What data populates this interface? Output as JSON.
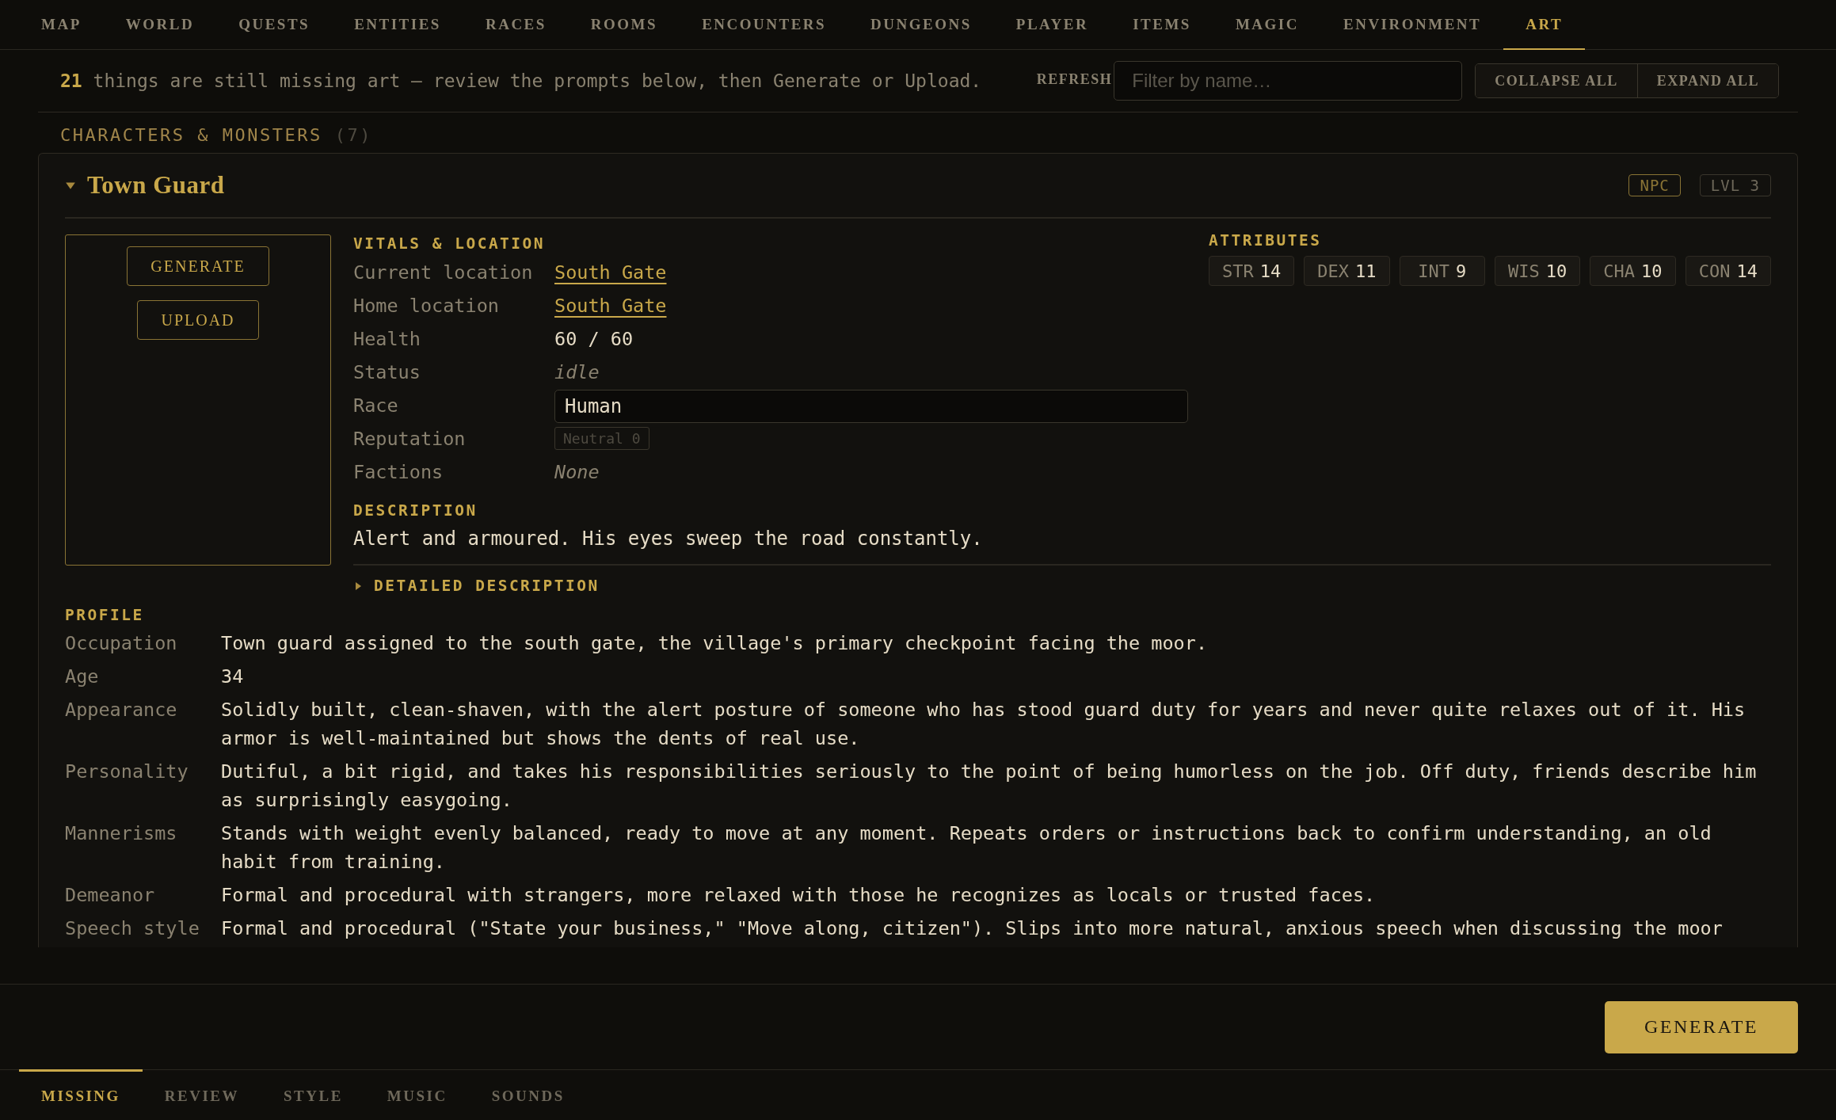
{
  "nav_tabs": [
    {
      "label": "MAP",
      "selected": false
    },
    {
      "label": "WORLD",
      "selected": false
    },
    {
      "label": "QUESTS",
      "selected": false
    },
    {
      "label": "ENTITIES",
      "selected": false
    },
    {
      "label": "RACES",
      "selected": false
    },
    {
      "label": "ROOMS",
      "selected": false
    },
    {
      "label": "ENCOUNTERS",
      "selected": false
    },
    {
      "label": "DUNGEONS",
      "selected": false
    },
    {
      "label": "PLAYER",
      "selected": false
    },
    {
      "label": "ITEMS",
      "selected": false
    },
    {
      "label": "MAGIC",
      "selected": false
    },
    {
      "label": "ENVIRONMENT",
      "selected": false
    },
    {
      "label": "ART",
      "selected": true
    }
  ],
  "toolbar": {
    "message": "**21** things are still missing art — review the prompts below, then Generate or Upload.",
    "refresh": "REFRESH",
    "filter": {
      "placeholder": "Filter by name…"
    },
    "buttons": [
      "COLLAPSE ALL",
      "EXPAND ALL"
    ]
  },
  "section": {
    "title": "CHARACTERS & MONSTERS",
    "count": "(7)"
  },
  "card": {
    "title": "Town Guard",
    "expanded": true,
    "badges": [
      {
        "label": "NPC",
        "kind": "type"
      },
      {
        "label": "LVL 3",
        "kind": "level"
      }
    ],
    "art_buttons": [
      "GENERATE",
      "UPLOAD"
    ],
    "vitals": {
      "heading": "VITALS & LOCATION",
      "rows": [
        {
          "label": "Current location",
          "value": "South Gate",
          "kind": "link"
        },
        {
          "label": "Home location",
          "value": "South Gate",
          "kind": "link"
        },
        {
          "label": "Health",
          "value": "60 / 60",
          "kind": "text"
        },
        {
          "label": "Status",
          "value": "idle",
          "kind": "italic"
        },
        {
          "label": "Race",
          "value": "Human",
          "kind": "field"
        },
        {
          "label": "Reputation",
          "value": "Neutral 0",
          "kind": "badge"
        },
        {
          "label": "Factions",
          "value": "None",
          "kind": "italic"
        }
      ]
    },
    "attributes": {
      "heading": "ATTRIBUTES",
      "items": [
        {
          "name": "STR",
          "value": "14"
        },
        {
          "name": "DEX",
          "value": "11"
        },
        {
          "name": "INT",
          "value": "9"
        },
        {
          "name": "WIS",
          "value": "10"
        },
        {
          "name": "CHA",
          "value": "10"
        },
        {
          "name": "CON",
          "value": "14"
        }
      ]
    },
    "description": {
      "heading": "DESCRIPTION",
      "text": "Alert and armoured. His eyes sweep the road constantly."
    },
    "detailed_description": {
      "label": "DETAILED DESCRIPTION",
      "expanded": false
    },
    "profile": {
      "heading": "PROFILE",
      "rows": [
        {
          "label": "Occupation",
          "value": "Town guard assigned to the south gate, the village's primary checkpoint facing the moor."
        },
        {
          "label": "Age",
          "value": "34"
        },
        {
          "label": "Appearance",
          "value": "Solidly built, clean-shaven, with the alert posture of someone who has stood guard duty for years and never quite relaxes out of it. His armor is well-maintained but shows the dents of real use."
        },
        {
          "label": "Personality",
          "value": "Dutiful, a bit rigid, and takes his responsibilities seriously to the point of being humorless on the job. Off duty, friends describe him as surprisingly easygoing."
        },
        {
          "label": "Mannerisms",
          "value": "Stands with weight evenly balanced, ready to move at any moment. Repeats orders or instructions back to confirm understanding, an old habit from training."
        },
        {
          "label": "Demeanor",
          "value": "Formal and procedural with strangers, more relaxed with those he recognizes as locals or trusted faces."
        },
        {
          "label": "Speech style",
          "value": "Formal and procedural (\"State your business,\" \"Move along, citizen\"). Slips into more natural, anxious speech when discussing the moor"
        }
      ]
    }
  },
  "footer": {
    "generate": "GENERATE",
    "tabs": [
      {
        "label": "MISSING",
        "selected": true
      },
      {
        "label": "REVIEW",
        "selected": false
      },
      {
        "label": "STYLE",
        "selected": false
      },
      {
        "label": "MUSIC",
        "selected": false
      },
      {
        "label": "SOUNDS",
        "selected": false
      }
    ]
  }
}
